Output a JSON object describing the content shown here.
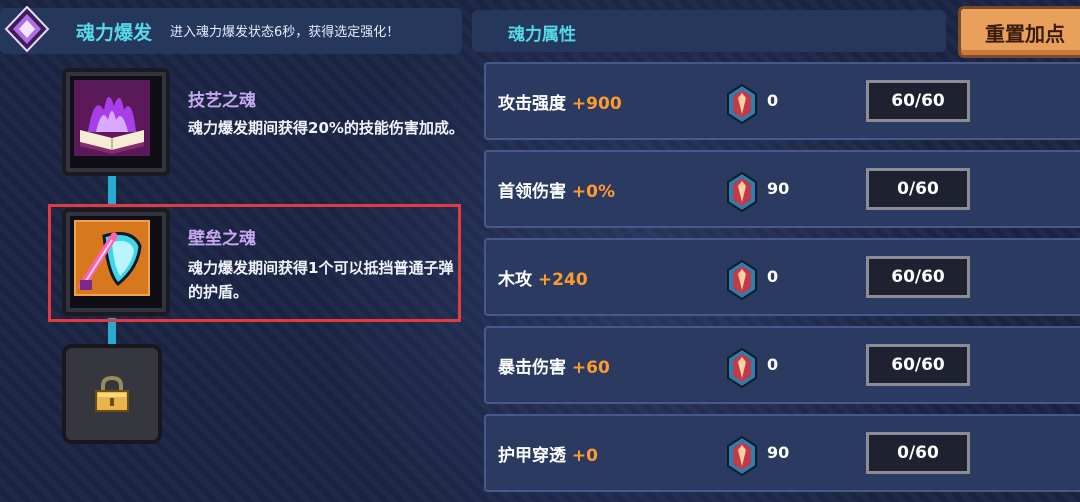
{
  "soul_burst": {
    "title": "魂力爆发",
    "description": "进入魂力爆发状态6秒，获得选定强化！"
  },
  "skills": [
    {
      "name": "技艺之魂",
      "description": "魂力爆发期间获得20%的技能伤害加成。",
      "icon": "flaming-book-icon",
      "selected": false
    },
    {
      "name": "壁垒之魂",
      "description": "魂力爆发期间获得1个可以抵挡普通子弹的护盾。",
      "icon": "shield-sword-icon",
      "selected": true
    },
    {
      "name": "",
      "description": "",
      "icon": "lock-icon",
      "locked": true
    }
  ],
  "attributes_panel": {
    "title": "魂力属性",
    "reset_label": "重置加点"
  },
  "attributes": [
    {
      "label": "攻击强度",
      "bonus": "+900",
      "gem_count": "0",
      "points": "60/60"
    },
    {
      "label": "首领伤害",
      "bonus": "+0%",
      "gem_count": "90",
      "points": "0/60"
    },
    {
      "label": "木攻",
      "bonus": "+240",
      "gem_count": "0",
      "points": "60/60"
    },
    {
      "label": "暴击伤害",
      "bonus": "+60",
      "gem_count": "0",
      "points": "60/60"
    },
    {
      "label": "护甲穿透",
      "bonus": "+0",
      "gem_count": "90",
      "points": "0/60"
    }
  ],
  "colors": {
    "accent_cyan": "#57d8e8",
    "bonus_orange": "#ff9a2e",
    "skill_name_purple": "#c7a8f0",
    "selection_red": "#e03a42",
    "reset_button": "#e8a05a"
  }
}
